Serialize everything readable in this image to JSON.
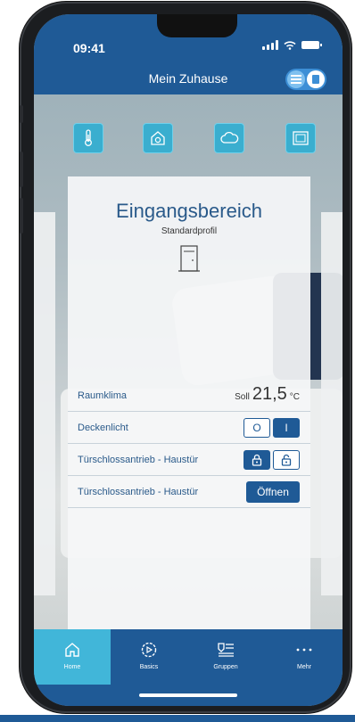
{
  "status": {
    "time": "09:41"
  },
  "nav": {
    "title": "Mein Zuhause"
  },
  "categories": [
    {
      "icon": "thermometer-icon"
    },
    {
      "icon": "house-icon"
    },
    {
      "icon": "cloud-icon"
    },
    {
      "icon": "window-icon"
    }
  ],
  "card": {
    "title": "Eingangsbereich",
    "subtitle": "Standardprofil",
    "rows": {
      "climate": {
        "label": "Raumklima",
        "soll": "Soll",
        "value": "21,5",
        "unit": "°C"
      },
      "light": {
        "label": "Deckenlicht",
        "off": "O",
        "on": "I",
        "state": "on"
      },
      "lock": {
        "label": "Türschlossantrieb - Haustür",
        "state": "locked"
      },
      "door": {
        "label": "Türschlossantrieb - Haustür",
        "button": "Öffnen"
      }
    }
  },
  "tabs": [
    {
      "label": "Home",
      "icon": "home-icon",
      "active": true
    },
    {
      "label": "Basics",
      "icon": "gear-play-icon",
      "active": false
    },
    {
      "label": "Gruppen",
      "icon": "groups-icon",
      "active": false
    },
    {
      "label": "Mehr",
      "icon": "more-icon",
      "active": false
    }
  ],
  "colors": {
    "primary": "#1f5a96",
    "accent": "#41b6d9",
    "text": "#2a5a8a"
  }
}
